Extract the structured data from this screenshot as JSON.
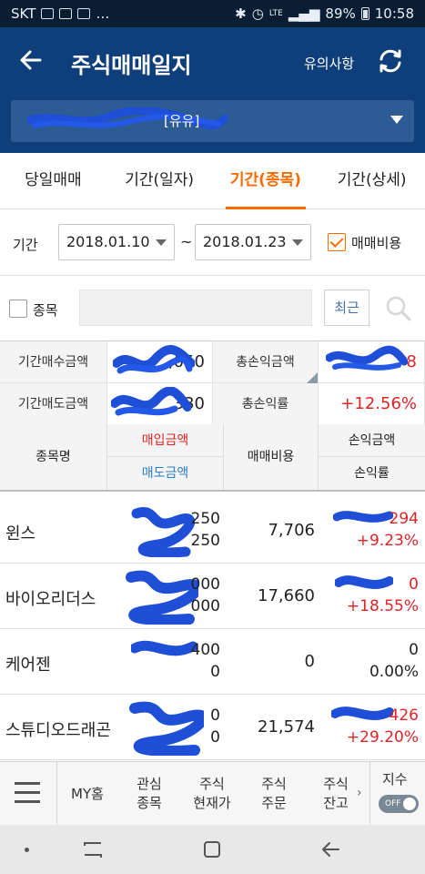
{
  "status_bar": {
    "carrier": "SKT",
    "network": "LTE",
    "battery": "89%",
    "time": "10:58"
  },
  "header": {
    "title": "주식매매일지",
    "notice_label": "유의사항"
  },
  "account": {
    "name_suffix": "[유유]"
  },
  "tabs": [
    {
      "label": "당일매매",
      "active": false
    },
    {
      "label": "기간(일자)",
      "active": false
    },
    {
      "label": "기간(종목)",
      "active": true
    },
    {
      "label": "기간(상세)",
      "active": false
    }
  ],
  "period": {
    "label": "기간",
    "start": "2018.01.10",
    "separator": "~",
    "end": "2018.01.23",
    "fee_checkbox_label": "매매비용",
    "fee_checked": true
  },
  "stock_filter": {
    "label": "종목",
    "input_value": "",
    "query_button": "최근"
  },
  "summary": {
    "buy_amount_label": "기간매수금액",
    "buy_amount_value": ",050",
    "total_pl_label": "총손익금액",
    "total_pl_value": "8",
    "sell_amount_label": "기간매도금액",
    "sell_amount_value": ",330",
    "total_rate_label": "총손익률",
    "total_rate_value": "+12.56%"
  },
  "table": {
    "headers": {
      "stock_name": "종목명",
      "buy_amount": "매입금액",
      "sell_amount": "매도금액",
      "fee": "매매비용",
      "pl_amount": "손익금액",
      "pl_rate": "손익률"
    },
    "rows": [
      {
        "name": "윈스",
        "buy": "250",
        "sell": "250",
        "fee": "7,706",
        "pl": "294",
        "rate": "+9.23%"
      },
      {
        "name": "바이오리더스",
        "buy": "000",
        "sell": "000",
        "fee": "17,660",
        "pl": "0",
        "rate": "+18.55%"
      },
      {
        "name": "케어젠",
        "buy": "400",
        "sell": "0",
        "fee": "0",
        "pl": "0",
        "rate": "0.00%"
      },
      {
        "name": "스튜디오드래곤",
        "buy": "0",
        "sell": "0",
        "fee": "21,574",
        "pl": "426",
        "rate": "+29.20%"
      }
    ]
  },
  "bottom_nav": {
    "items": [
      "MY홈",
      "관심\n종목",
      "주식\n현재가",
      "주식\n주문",
      "주식\n잔고"
    ],
    "index_label": "지수",
    "toggle_label": "OFF"
  },
  "colors": {
    "header_bg": "#0e3f7a",
    "accent_orange": "#ff6a00",
    "profit_red": "#e02424",
    "label_blue": "#2b7cc0"
  }
}
